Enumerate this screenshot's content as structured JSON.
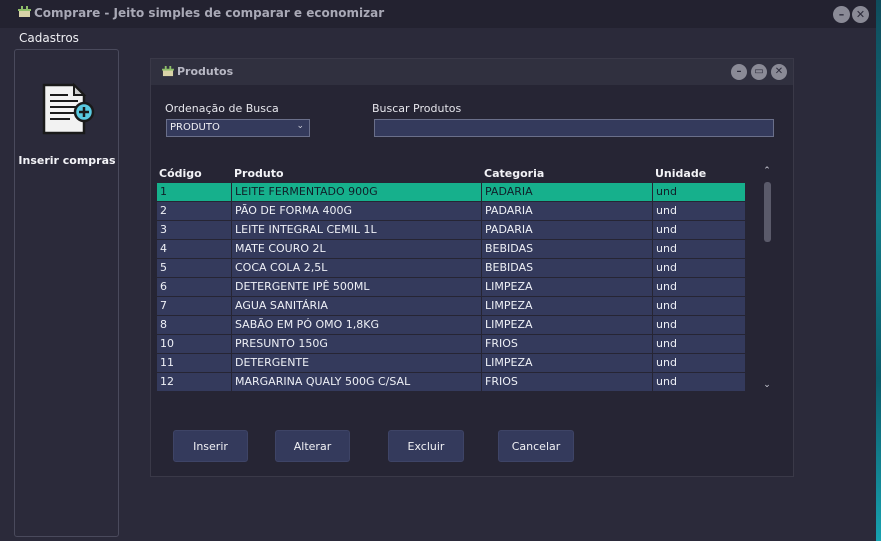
{
  "app": {
    "title": "Comprare - Jeito simples de comparar e economizar",
    "icon": "basket-icon",
    "window_buttons": [
      "minimize-icon",
      "close-icon"
    ]
  },
  "menu": {
    "items": [
      {
        "label": "Cadastros"
      }
    ]
  },
  "sidebar": {
    "action": {
      "label": "Inserir compras",
      "icon": "document-add-icon"
    }
  },
  "dialog": {
    "title": "Produtos",
    "icon": "basket-icon",
    "window_buttons": [
      "minimize-icon",
      "maximize-icon",
      "close-icon"
    ],
    "sort": {
      "label": "Ordenação de Busca",
      "selected": "PRODUTO"
    },
    "search": {
      "label": "Buscar Produtos",
      "value": ""
    },
    "table": {
      "columns": [
        "Código",
        "Produto",
        "Categoria",
        "Unidade"
      ],
      "selected_row": 0,
      "rows": [
        [
          "1",
          "LEITE FERMENTADO 900G",
          "PADARIA",
          "und"
        ],
        [
          "2",
          "PÃO DE FORMA 400G",
          "PADARIA",
          "und"
        ],
        [
          "3",
          "LEITE INTEGRAL CEMIL 1L",
          "PADARIA",
          "und"
        ],
        [
          "4",
          "MATE COURO 2L",
          "BEBIDAS",
          "und"
        ],
        [
          "5",
          "COCA COLA 2,5L",
          "BEBIDAS",
          "und"
        ],
        [
          "6",
          "DETERGENTE IPÊ 500ML",
          "LIMPEZA",
          "und"
        ],
        [
          "7",
          "AGUA SANITÁRIA",
          "LIMPEZA",
          "und"
        ],
        [
          "8",
          "SABÃO EM PÓ OMO 1,8KG",
          "LIMPEZA",
          "und"
        ],
        [
          "10",
          "PRESUNTO 150G",
          "FRIOS",
          "und"
        ],
        [
          "11",
          "DETERGENTE",
          "LIMPEZA",
          "und"
        ],
        [
          "12",
          "MARGARINA QUALY 500G C/SAL",
          "FRIOS",
          "und"
        ]
      ]
    },
    "buttons": {
      "insert": "Inserir",
      "edit": "Alterar",
      "delete": "Excluir",
      "cancel": "Cancelar"
    }
  },
  "colors": {
    "window_bg": "#2b2a3a",
    "input_bg": "#343a5c",
    "selection": "#16b08c"
  }
}
